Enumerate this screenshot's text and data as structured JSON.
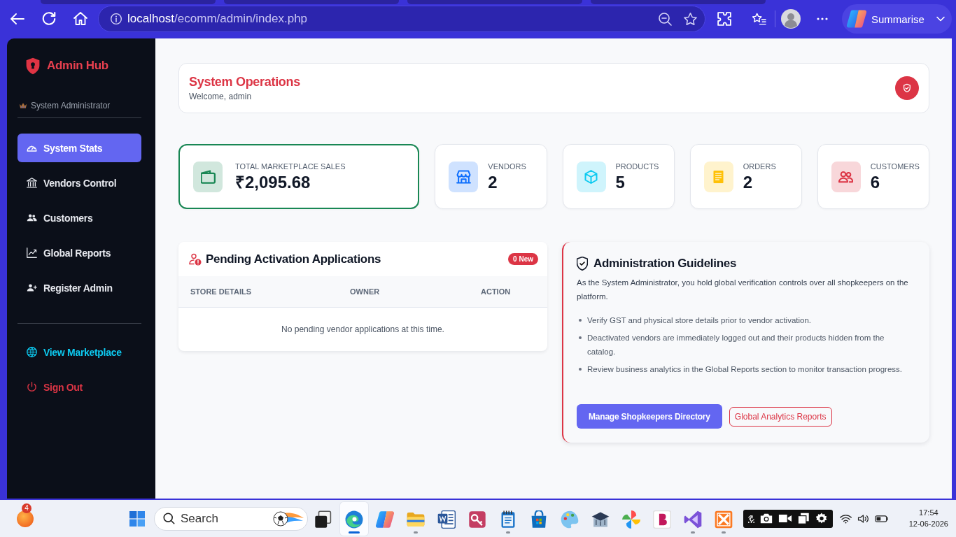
{
  "browser": {
    "url_host": "localhost",
    "url_path": "/ecomm/admin/index.php",
    "assistant_label": "Summarise"
  },
  "sidebar": {
    "brand": "Admin Hub",
    "role": "System Administrator",
    "nav": [
      {
        "label": "System Stats",
        "selected": true
      },
      {
        "label": "Vendors Control",
        "selected": false
      },
      {
        "label": "Customers",
        "selected": false
      },
      {
        "label": "Global Reports",
        "selected": false
      },
      {
        "label": "Register Admin",
        "selected": false
      }
    ],
    "links": [
      {
        "label": "View Marketplace",
        "color": "#0dcaf0"
      },
      {
        "label": "Sign Out",
        "color": "#dc3545"
      }
    ]
  },
  "header": {
    "title": "System Operations",
    "subtitle": "Welcome, admin"
  },
  "stats": [
    {
      "label": "TOTAL MARKETPLACE SALES",
      "value": "₹2,095.68",
      "color": "#198754",
      "highlighted": true
    },
    {
      "label": "VENDORS",
      "value": "2",
      "color": "#0d6efd",
      "highlighted": false
    },
    {
      "label": "PRODUCTS",
      "value": "5",
      "color": "#0dcaf0",
      "highlighted": false
    },
    {
      "label": "ORDERS",
      "value": "2",
      "color": "#ffc107",
      "highlighted": false
    },
    {
      "label": "CUSTOMERS",
      "value": "6",
      "color": "#dc3545",
      "highlighted": false
    }
  ],
  "pending": {
    "title": "Pending Activation Applications",
    "badge": "0 New",
    "columns": [
      "STORE DETAILS",
      "OWNER",
      "ACTION"
    ],
    "empty_message": "No pending vendor applications at this time."
  },
  "guidelines": {
    "title": "Administration Guidelines",
    "intro": "As the System Administrator, you hold global verification controls over all shopkeepers on the platform.",
    "points": [
      "Verify GST and physical store details prior to vendor activation.",
      "Deactivated vendors are immediately logged out and their products hidden from the catalog.",
      "Review business analytics in the Global Reports section to monitor transaction progress."
    ],
    "buttons": [
      {
        "label": "Manage Shopkeepers Directory",
        "kind": "primary"
      },
      {
        "label": "Global Analytics Reports",
        "kind": "outline"
      }
    ]
  },
  "taskbar": {
    "notification_count": "4",
    "search": {
      "placeholder": "Search"
    },
    "apps": [
      {
        "selected": false,
        "running": false
      },
      {
        "selected": true,
        "running": true
      },
      {
        "selected": false,
        "running": false
      },
      {
        "selected": false,
        "running": true
      },
      {
        "selected": false,
        "running": false
      },
      {
        "selected": false,
        "running": false
      },
      {
        "selected": false,
        "running": true
      },
      {
        "selected": false,
        "running": false
      },
      {
        "selected": false,
        "running": false
      },
      {
        "selected": false,
        "running": false
      },
      {
        "selected": false,
        "running": false
      },
      {
        "selected": false,
        "running": false
      },
      {
        "selected": false,
        "running": true
      },
      {
        "selected": false,
        "running": true
      }
    ],
    "clock": {
      "time": "17:54",
      "date": "12-06-2026"
    }
  }
}
